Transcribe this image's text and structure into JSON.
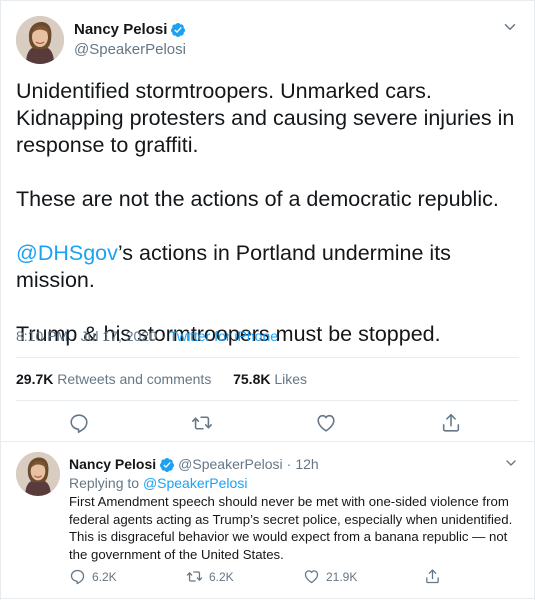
{
  "main_tweet": {
    "author_name": "Nancy Pelosi",
    "author_handle": "@SpeakerPelosi",
    "text_lines": [
      "Unidentified stormtroopers. Unmarked cars. Kidnapping protesters and causing severe injuries in response to graffiti.",
      "These are not the actions of a democratic republic.",
      "’s actions in Portland undermine its mission.",
      "Trump & his stormtroopers must be stopped."
    ],
    "mention": "@DHSgov",
    "timestamp": "8:10 PM · Jul 17, 2020",
    "separator": " · ",
    "source": "Twitter for iPhone",
    "retweets_count": "29.7K",
    "retweets_label": "Retweets and comments",
    "likes_count": "75.8K",
    "likes_label": "Likes"
  },
  "reply_tweet": {
    "author_name": "Nancy Pelosi",
    "author_handle": "@SpeakerPelosi",
    "dot": "·",
    "time": "12h",
    "replying_label": "Replying to",
    "replying_to": "@SpeakerPelosi",
    "text": "First Amendment speech should never be met with one-sided violence from federal agents acting as Trump’s secret police, especially when unidentified. This is disgraceful behavior we would expect from a banana republic — not the government of the United States.",
    "reply_count": "6.2K",
    "retweet_count": "6.2K",
    "like_count": "21.9K"
  },
  "colors": {
    "accent": "#1da1f2",
    "text": "#14171a",
    "secondary": "#657786",
    "border": "#e6ecf0"
  },
  "icons": [
    "verified-badge-icon",
    "chevron-down-icon",
    "reply-icon",
    "retweet-icon",
    "like-icon",
    "share-icon"
  ]
}
